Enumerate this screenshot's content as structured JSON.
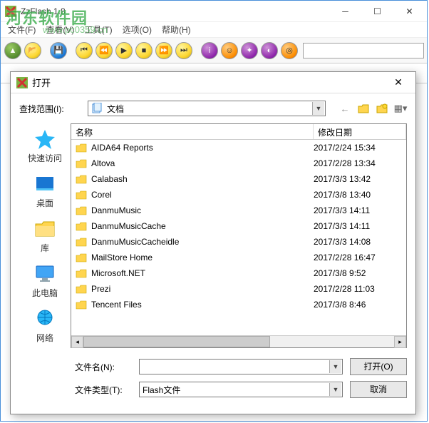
{
  "watermark": {
    "text": "河东软件园",
    "url": "www.pc0359.cn"
  },
  "main": {
    "title": "ZzFlash 1.8",
    "menu": {
      "file": "文件(F)",
      "view": "查看(V)",
      "tools": "工具(T)",
      "options": "选项(O)",
      "help": "帮助(H)"
    },
    "toolbar_icons": {
      "open": "▶",
      "browse": "📂",
      "save": "💾",
      "first": "|◀",
      "prev": "◀◀",
      "play": "▶|",
      "stop": "■",
      "next": "▶▶",
      "last": "▶|",
      "info": "i",
      "face": "☺",
      "tool": "⚙",
      "purple": "●",
      "orange": "◎"
    }
  },
  "dialog": {
    "title": "打开",
    "lookin_label": "查找范围(I):",
    "lookin_value": "文档",
    "nav": {
      "back": "←",
      "up": "📁",
      "new": "📂",
      "views": "▦"
    },
    "places": [
      {
        "name": "quick",
        "label": "快速访问",
        "icon": "star"
      },
      {
        "name": "desktop",
        "label": "桌面",
        "icon": "desktop"
      },
      {
        "name": "libraries",
        "label": "库",
        "icon": "library"
      },
      {
        "name": "thispc",
        "label": "此电脑",
        "icon": "pc"
      },
      {
        "name": "network",
        "label": "网络",
        "icon": "network"
      }
    ],
    "columns": {
      "name": "名称",
      "date": "修改日期"
    },
    "files": [
      {
        "name": "AIDA64 Reports",
        "date": "2017/2/24 15:34"
      },
      {
        "name": "Altova",
        "date": "2017/2/28 13:34"
      },
      {
        "name": "Calabash",
        "date": "2017/3/3 13:42"
      },
      {
        "name": "Corel",
        "date": "2017/3/8 13:40"
      },
      {
        "name": "DanmuMusic",
        "date": "2017/3/3 14:11"
      },
      {
        "name": "DanmuMusicCache",
        "date": "2017/3/3 14:11"
      },
      {
        "name": "DanmuMusicCacheidle",
        "date": "2017/3/3 14:08"
      },
      {
        "name": "MailStore Home",
        "date": "2017/2/28 16:47"
      },
      {
        "name": "Microsoft.NET",
        "date": "2017/3/8 9:52"
      },
      {
        "name": "Prezi",
        "date": "2017/2/28 11:03"
      },
      {
        "name": "Tencent Files",
        "date": "2017/3/8 8:46"
      }
    ],
    "filename_label": "文件名(N):",
    "filename_value": "",
    "filetype_label": "文件类型(T):",
    "filetype_value": "Flash文件",
    "open_btn": "打开(O)",
    "cancel_btn": "取消"
  }
}
